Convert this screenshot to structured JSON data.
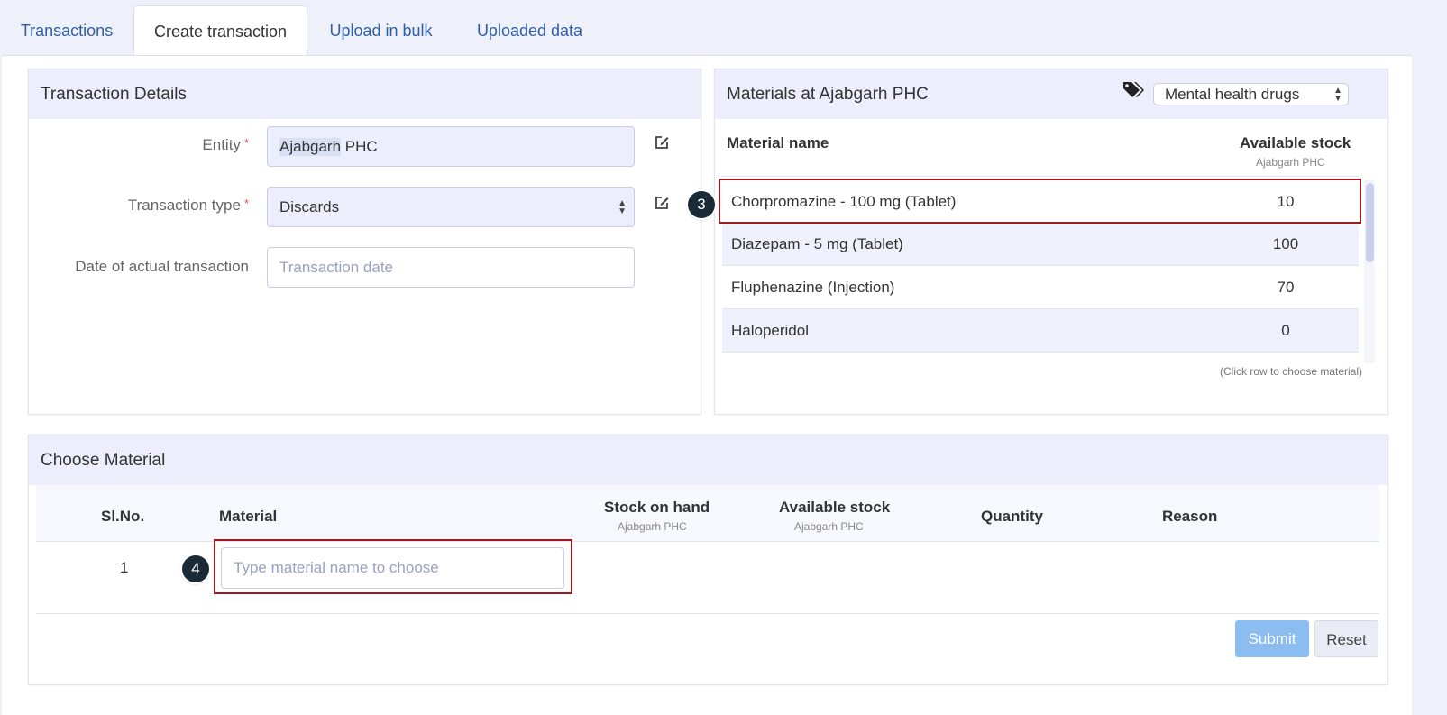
{
  "tabs": [
    {
      "label": "Transactions"
    },
    {
      "label": "Create transaction"
    },
    {
      "label": "Upload in bulk"
    },
    {
      "label": "Uploaded data"
    }
  ],
  "transaction_details": {
    "title": "Transaction Details",
    "entity": {
      "label": "Entity",
      "required_mark": "*",
      "value_highlight": "Ajabgarh",
      "value_rest": " PHC"
    },
    "transaction_type": {
      "label": "Transaction type",
      "required_mark": "*",
      "value": "Discards"
    },
    "date": {
      "label": "Date of actual transaction",
      "placeholder": "Transaction date"
    }
  },
  "materials_panel": {
    "title": "Materials at Ajabgarh PHC",
    "tag_icon": "tags-icon",
    "filter_value": "Mental health drugs",
    "col_name": "Material name",
    "col_stock": "Available stock",
    "col_stock_sub": "Ajabgarh PHC",
    "rows": [
      {
        "name": "Chorpromazine - 100 mg (Tablet)",
        "stock": "10"
      },
      {
        "name": "Diazepam - 5 mg (Tablet)",
        "stock": "100"
      },
      {
        "name": "Fluphenazine (Injection)",
        "stock": "70"
      },
      {
        "name": "Haloperidol",
        "stock": "0"
      }
    ],
    "hint": "(Click row to choose material)"
  },
  "choose_material": {
    "title": "Choose Material",
    "headers": {
      "slno": "Sl.No.",
      "material": "Material",
      "stock_on_hand": "Stock on hand",
      "stock_on_hand_sub": "Ajabgarh PHC",
      "available_stock": "Available stock",
      "available_stock_sub": "Ajabgarh PHC",
      "quantity": "Quantity",
      "reason": "Reason"
    },
    "row_number": "1",
    "material_placeholder": "Type material name to choose",
    "submit_label": "Submit",
    "reset_label": "Reset"
  },
  "callouts": {
    "step3": "3",
    "step4": "4"
  },
  "colors": {
    "accent_blue": "#2e5fa8",
    "callout_red": "#9b1b1f",
    "submit_disabled": "#8cbdf0"
  }
}
